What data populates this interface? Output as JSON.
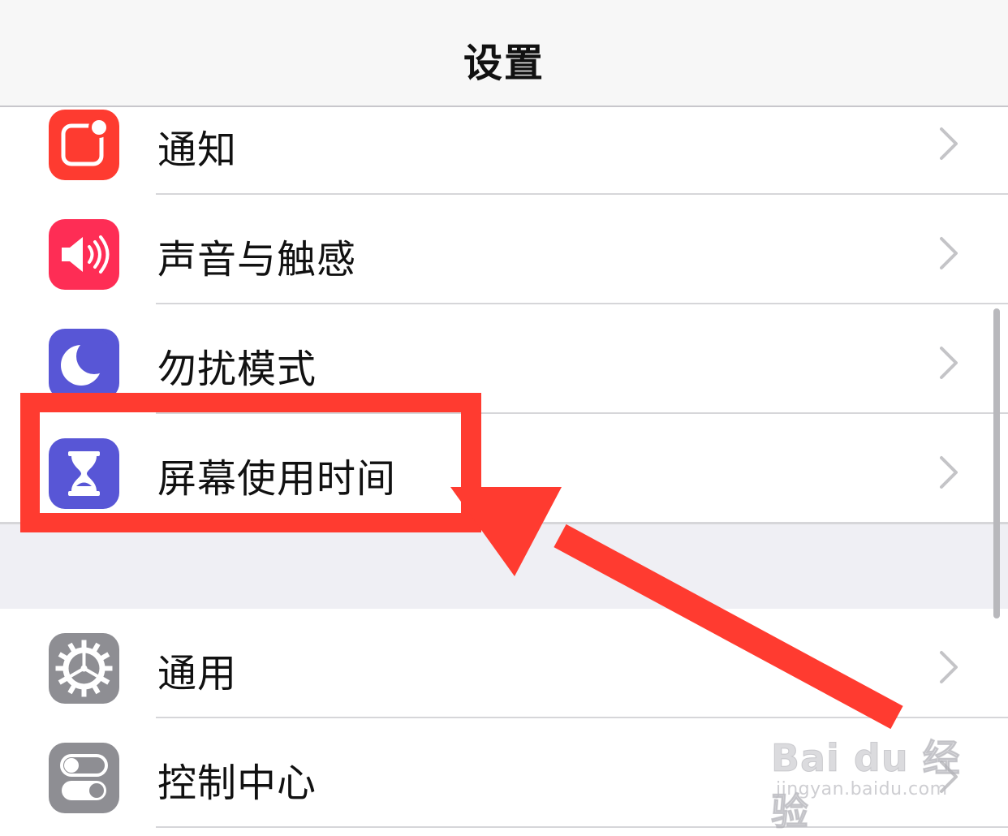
{
  "header": {
    "title": "设置"
  },
  "settings": [
    {
      "label": "通知",
      "icon": "notifications-icon",
      "color": "#fe3b30"
    },
    {
      "label": "声音与触感",
      "icon": "speaker-icon",
      "color": "#fe2d55"
    },
    {
      "label": "勿扰模式",
      "icon": "moon-icon",
      "color": "#5856d6"
    },
    {
      "label": "屏幕使用时间",
      "icon": "hourglass-icon",
      "color": "#5856d6"
    },
    {
      "label": "通用",
      "icon": "gear-icon",
      "color": "#8e8e93"
    },
    {
      "label": "控制中心",
      "icon": "toggles-icon",
      "color": "#8e8e93"
    }
  ],
  "annotation": {
    "color": "#ff3b30"
  },
  "watermark": {
    "logo": "Bai du 经验",
    "url": "jingyan.baidu.com"
  }
}
